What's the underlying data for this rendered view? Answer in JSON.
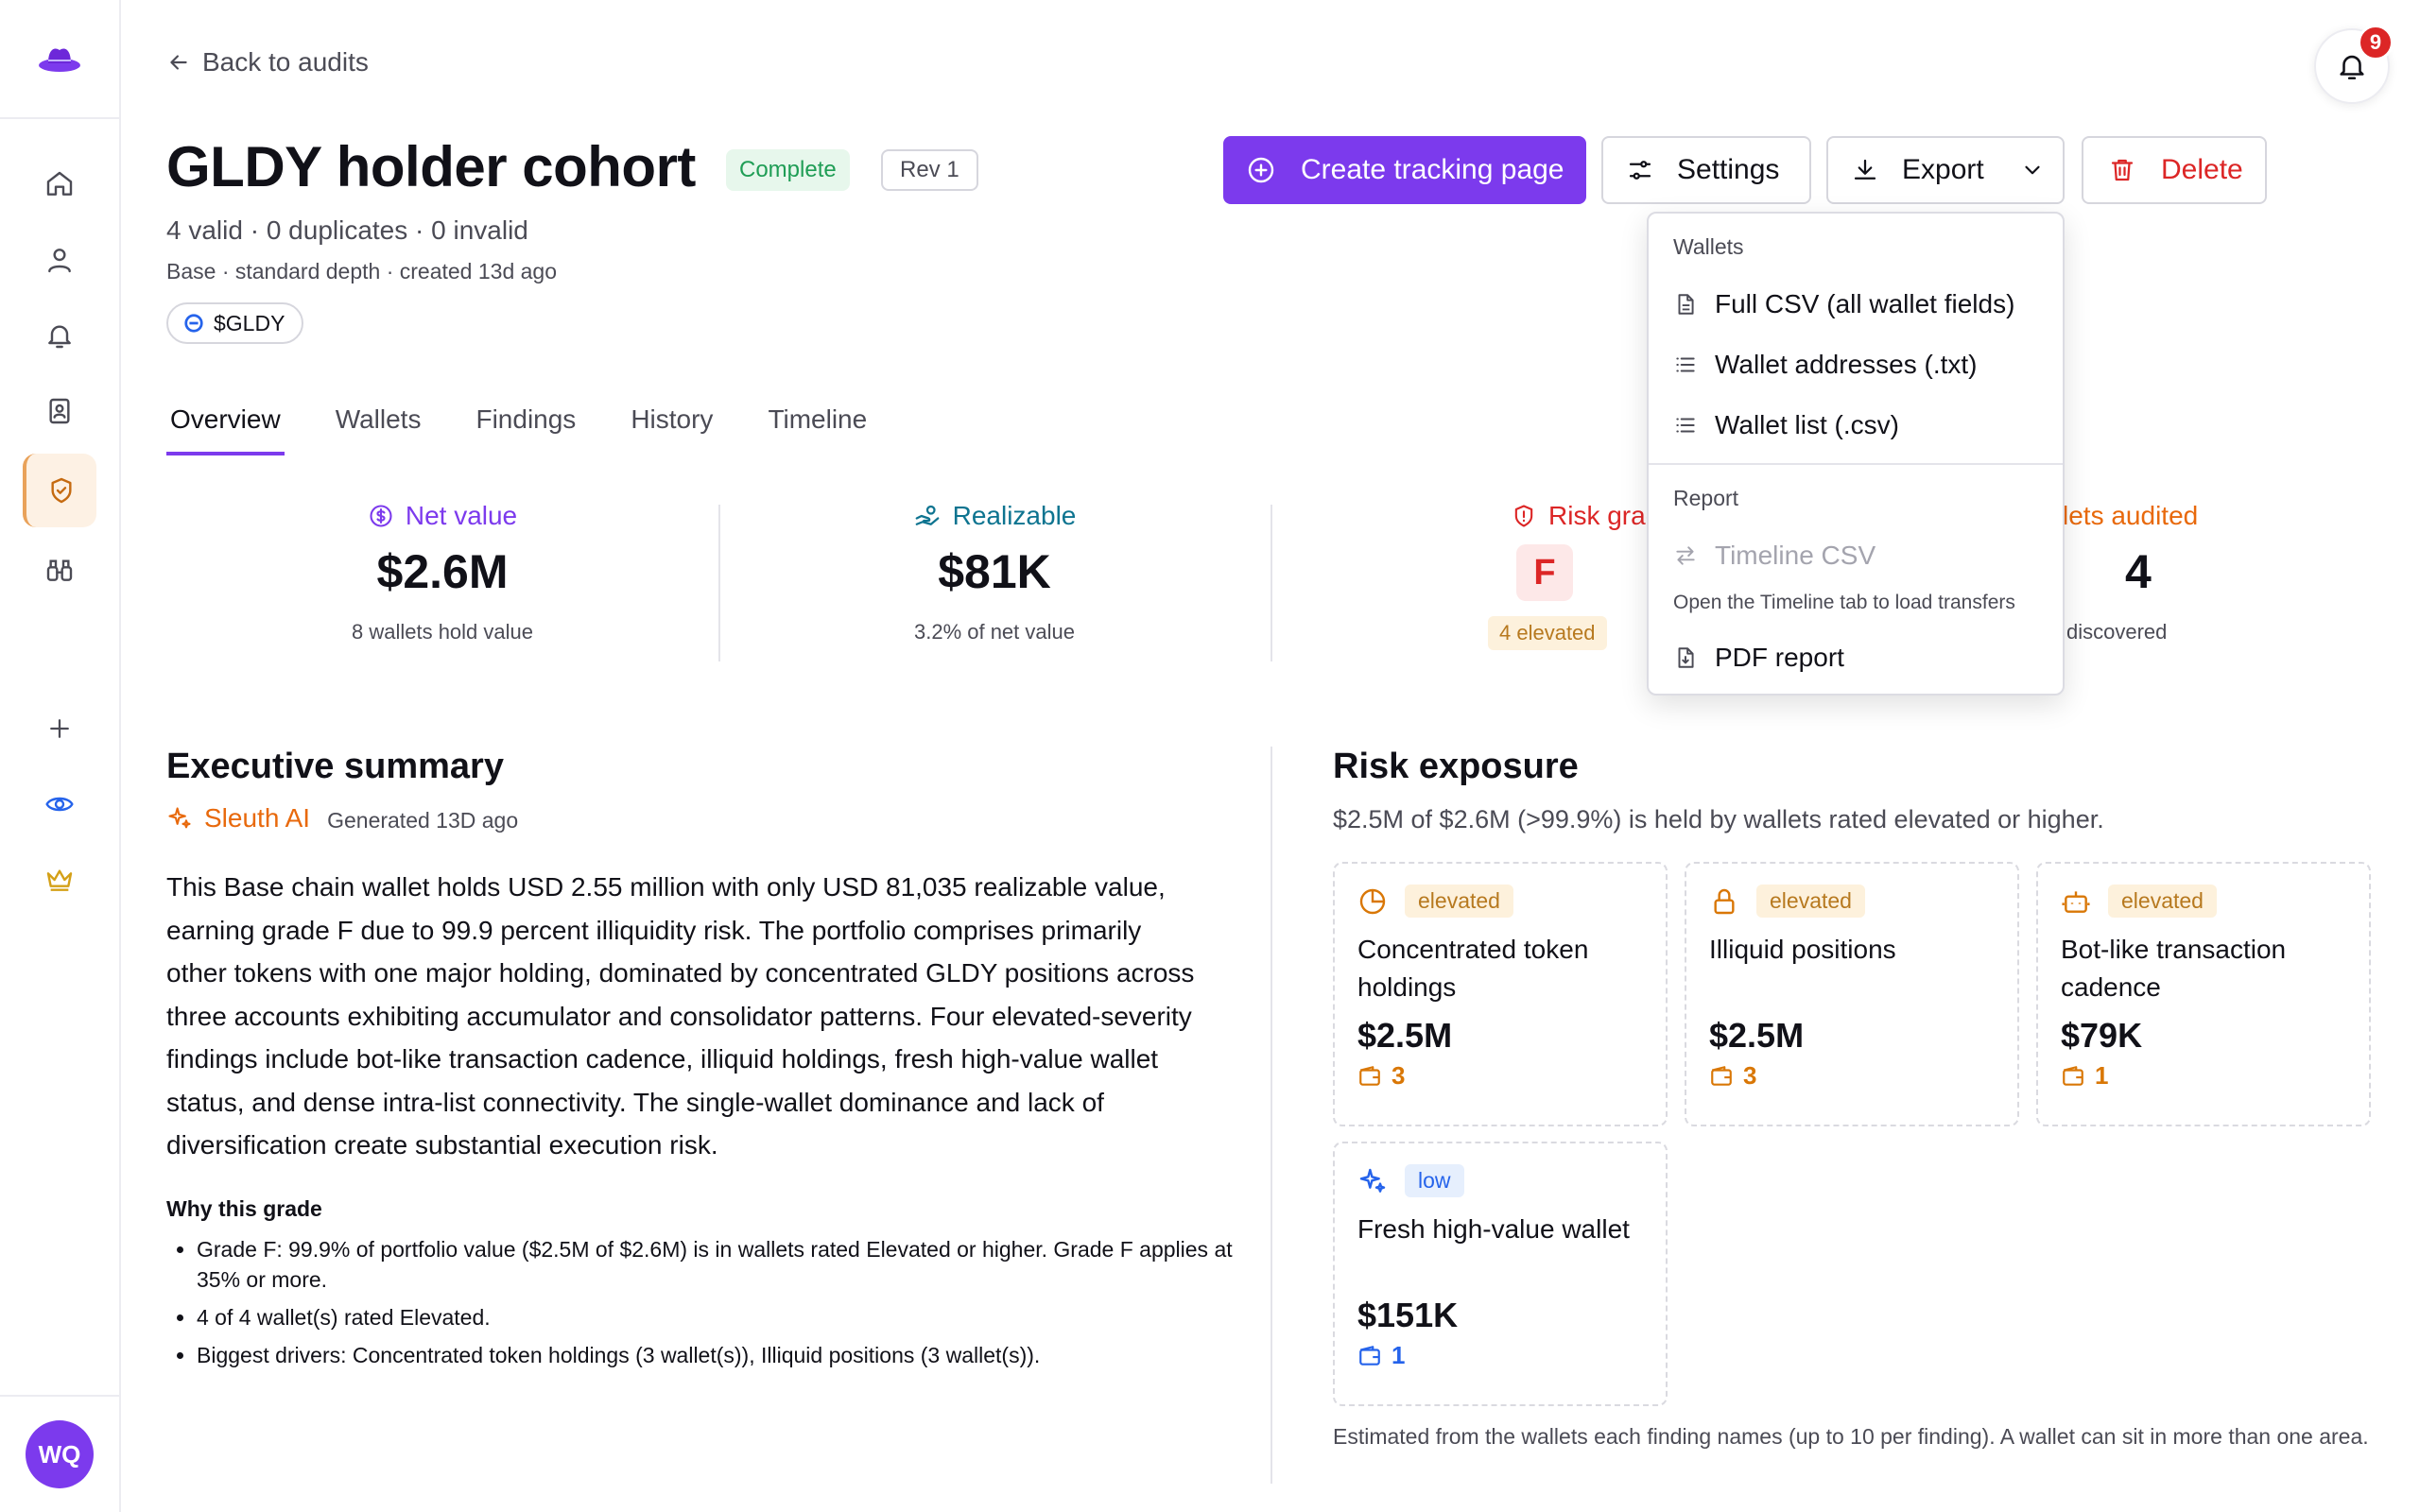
{
  "nav": {
    "back_label": "Back to audits",
    "notification_count": "9",
    "avatar_initials": "WQ"
  },
  "header": {
    "title": "GLDY holder cohort",
    "status_badge": "Complete",
    "revision_badge": "Rev 1",
    "stats_line": "4 valid · 0 duplicates · 0 invalid",
    "meta_line": "Base · standard depth · created 13d ago",
    "token_chip": "$GLDY"
  },
  "actions": {
    "create_label": "Create tracking page",
    "settings_label": "Settings",
    "export_label": "Export",
    "delete_label": "Delete"
  },
  "tabs": [
    {
      "label": "Overview",
      "active": true
    },
    {
      "label": "Wallets",
      "active": false
    },
    {
      "label": "Findings",
      "active": false
    },
    {
      "label": "History",
      "active": false
    },
    {
      "label": "Timeline",
      "active": false
    }
  ],
  "stats": {
    "net_value": {
      "label": "Net value",
      "value": "$2.6M",
      "sub": "8 wallets hold value",
      "color": "#7c3aed"
    },
    "realizable": {
      "label": "Realizable",
      "value": "$81K",
      "sub": "3.2% of net value",
      "color": "#0e7490"
    },
    "risk_grade": {
      "label": "Risk grade",
      "value": "F",
      "sub": "4 elevated",
      "color": "#dc2626"
    },
    "wallets_audited": {
      "label": "lets audited",
      "value": "4",
      "sub": "discovered",
      "color": "#e8690c"
    }
  },
  "executive_summary": {
    "heading": "Executive summary",
    "ai_name": "Sleuth AI",
    "generated": "Generated 13D ago",
    "body": "This Base chain wallet holds USD 2.55 million with only USD 81,035 realizable value, earning grade F due to 99.9 percent illiquidity risk. The portfolio comprises primarily other tokens with one major holding, dominated by concentrated GLDY positions across three accounts exhibiting accumulator and consolidator patterns. Four elevated-severity findings include bot-like transaction cadence, illiquid holdings, fresh high-value wallet status, and dense intra-list connectivity. The single-wallet dominance and lack of diversification create substantial execution risk.",
    "why_heading": "Why this grade",
    "why_items": [
      "Grade F: 99.9% of portfolio value ($2.5M of $2.6M) is in wallets rated Elevated or higher. Grade F applies at 35% or more.",
      "4 of 4 wallet(s) rated Elevated.",
      "Biggest drivers: Concentrated token holdings (3 wallet(s)), Illiquid positions (3 wallet(s))."
    ]
  },
  "risk_exposure": {
    "heading": "Risk exposure",
    "subtitle": "$2.5M of $2.6M (>99.9%) is held by wallets rated elevated or higher.",
    "cards": [
      {
        "severity": "elevated",
        "title": "Concentrated token holdings",
        "value": "$2.5M",
        "count": "3",
        "icon": "pie-chart-icon"
      },
      {
        "severity": "elevated",
        "title": "Illiquid positions",
        "value": "$2.5M",
        "count": "3",
        "icon": "lock-icon"
      },
      {
        "severity": "elevated",
        "title": "Bot-like transaction cadence",
        "value": "$79K",
        "count": "1",
        "icon": "bot-icon"
      },
      {
        "severity": "low",
        "title": "Fresh high-value wallet",
        "value": "$151K",
        "count": "1",
        "icon": "sparkles-icon"
      }
    ],
    "footnote": "Estimated from the wallets each finding names (up to 10 per finding). A wallet can sit in more than one area."
  },
  "export_menu": {
    "wallets_section": "Wallets",
    "full_csv": "Full CSV (all wallet fields)",
    "wallet_addresses": "Wallet addresses (.txt)",
    "wallet_list": "Wallet list (.csv)",
    "report_section": "Report",
    "timeline_csv": "Timeline CSV",
    "timeline_hint": "Open the Timeline tab to load transfers",
    "pdf_report": "PDF report"
  },
  "colors": {
    "accent": "#7c3aed",
    "danger": "#dc2626",
    "warning": "#b7791f",
    "success": "#1f9d55",
    "sleuth": "#e8690c"
  }
}
